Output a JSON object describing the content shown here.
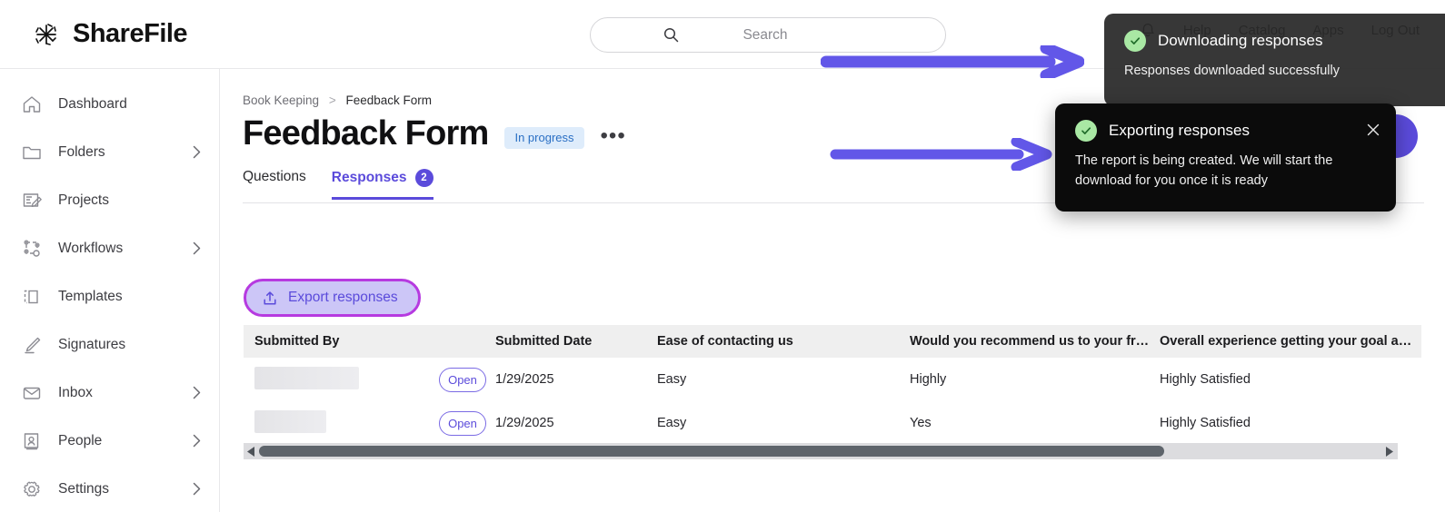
{
  "header": {
    "brand_name": "ShareFile",
    "brand_logo_icon": "sharefile-starburst-icon",
    "search": {
      "placeholder": "Search",
      "value": "",
      "icon": "search-icon"
    },
    "nav": {
      "notifications_icon": "bell-icon",
      "items": [
        {
          "label": "Help"
        },
        {
          "label": "Catalog"
        },
        {
          "label": "Apps"
        },
        {
          "label": "Log Out"
        }
      ]
    }
  },
  "sidebar": {
    "items": [
      {
        "label": "Dashboard",
        "icon": "home-icon",
        "has_chevron": false
      },
      {
        "label": "Folders",
        "icon": "folder-icon",
        "has_chevron": true
      },
      {
        "label": "Projects",
        "icon": "projects-icon",
        "has_chevron": false
      },
      {
        "label": "Workflows",
        "icon": "workflows-icon",
        "has_chevron": true
      },
      {
        "label": "Templates",
        "icon": "templates-icon",
        "has_chevron": false
      },
      {
        "label": "Signatures",
        "icon": "signature-icon",
        "has_chevron": false
      },
      {
        "label": "Inbox",
        "icon": "envelope-icon",
        "has_chevron": true
      },
      {
        "label": "People",
        "icon": "people-icon",
        "has_chevron": true
      },
      {
        "label": "Settings",
        "icon": "gear-icon",
        "has_chevron": true
      }
    ]
  },
  "main": {
    "breadcrumb": {
      "parent": "Book Keeping",
      "separator": ">",
      "current": "Feedback Form"
    },
    "page_title": "Feedback Form",
    "status_badge": "In progress",
    "more_menu": "•••",
    "tabs": [
      {
        "label": "Questions",
        "active": false,
        "count": null
      },
      {
        "label": "Responses",
        "active": true,
        "count": "2"
      }
    ],
    "export_button": {
      "label": "Export responses",
      "icon": "upload-icon"
    },
    "table": {
      "columns": [
        "Submitted By",
        "",
        "Submitted Date",
        "Ease of contacting us",
        "Would you recommend us to your frie…",
        "Overall experience getting your goal a…"
      ],
      "rows": [
        {
          "submitted_by": "",
          "submitted_by_redacted_width": 115,
          "open_label": "Open",
          "submitted_date": "1/29/2025",
          "ease_of_contacting_us": "Easy",
          "would_you_recommend": "Highly",
          "overall_experience": "Highly Satisfied"
        },
        {
          "submitted_by": "",
          "submitted_by_redacted_width": 79,
          "open_label": "Open",
          "submitted_date": "1/29/2025",
          "ease_of_contacting_us": "Easy",
          "would_you_recommend": "Yes",
          "overall_experience": "Highly Satisfied"
        }
      ]
    },
    "scrollbar": {
      "left_arrow_icon": "triangle-left-icon",
      "right_arrow_icon": "triangle-right-icon"
    }
  },
  "toasts": [
    {
      "title": "Downloading responses",
      "body": "Responses downloaded successfully",
      "status_icon": "check-circle-icon",
      "close_icon": "close-icon"
    },
    {
      "title": "Exporting responses",
      "body": "The report is being created. We will start the download for you once it is ready",
      "status_icon": "check-circle-icon",
      "close_icon": "close-icon"
    }
  ],
  "annotations": [
    {
      "type": "arrow-right",
      "name": "annotation-arrow-top"
    },
    {
      "type": "arrow-right",
      "name": "annotation-arrow-bottom"
    }
  ],
  "colors": {
    "accent_purple": "#5b4bdb",
    "annotation_purple": "#6257e8",
    "highlight_ring": "#b63ae0",
    "badge_blue_bg": "#deecfb",
    "badge_blue_text": "#2a6fc4",
    "toast_dark": "#0b0b0b",
    "success_green": "#a9e8a4"
  }
}
